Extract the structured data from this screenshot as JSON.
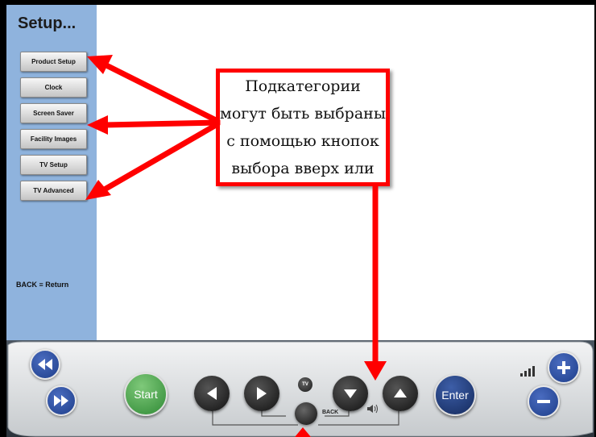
{
  "sidebar": {
    "title": "Setup...",
    "items": [
      {
        "label": "Product Setup"
      },
      {
        "label": "Clock"
      },
      {
        "label": "Screen Saver"
      },
      {
        "label": "Facility Images"
      },
      {
        "label": "TV Setup"
      },
      {
        "label": "TV Advanced"
      }
    ],
    "back_hint": "BACK ≡ Return"
  },
  "callout": {
    "text": "Подкатегории могут быть выбраны с помощью кнопок выбора вверх или"
  },
  "remote": {
    "start_label": "Start",
    "enter_label": "Enter",
    "back_label": "BACK",
    "tv_label": "TV",
    "icons": [
      "rewind-icon",
      "fast-forward-icon",
      "left-arrow-icon",
      "right-arrow-icon",
      "down-arrow-icon",
      "up-arrow-icon",
      "plus-icon",
      "minus-icon",
      "signal-icon",
      "speaker-icon"
    ]
  },
  "colors": {
    "sidebar": "#8fb3dd",
    "callout_border": "#ff0000",
    "start_button": "#3e9a3e",
    "enter_button": "#1c3a78",
    "nav_button": "#1f1f1f",
    "round_blue": "#1e3e8a"
  }
}
